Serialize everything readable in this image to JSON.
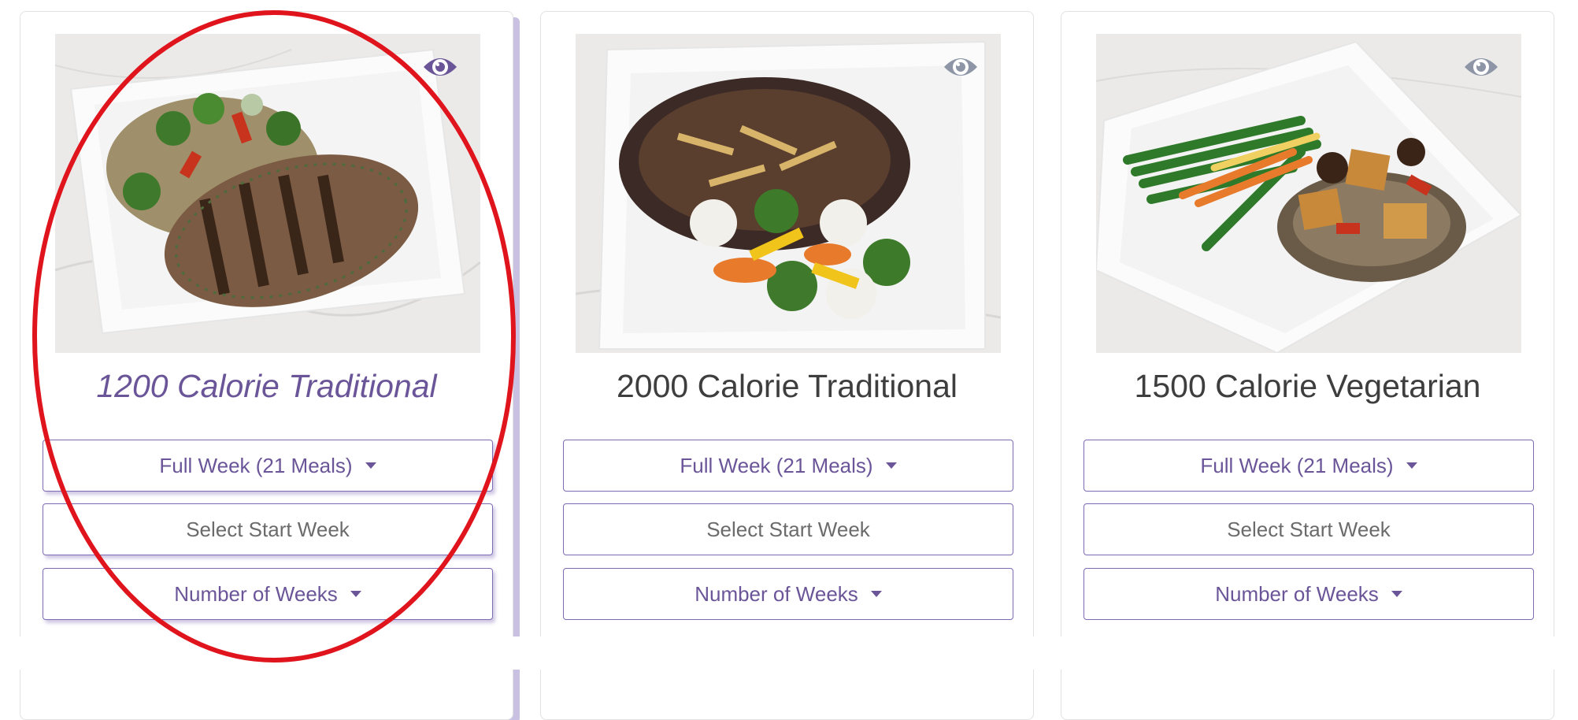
{
  "colors": {
    "accent": "#6a5598",
    "button_border": "#7c6ab3",
    "annotation": "#e0141c",
    "eye_icon": "#8d95a6",
    "eye_icon_active": "#6a5598"
  },
  "cards": [
    {
      "title": "1200 Calorie Traditional",
      "selected": true,
      "image": "grilled-chicken-plate",
      "eye_icon": "eye-icon",
      "meals_dropdown": "Full Week (21 Meals)",
      "start_week": "Select Start Week",
      "weeks_dropdown": "Number of Weeks"
    },
    {
      "title": "2000 Calorie Traditional",
      "selected": false,
      "image": "beef-rice-vegetable-plate",
      "eye_icon": "eye-icon",
      "meals_dropdown": "Full Week (21 Meals)",
      "start_week": "Select Start Week",
      "weeks_dropdown": "Number of Weeks"
    },
    {
      "title": "1500 Calorie Vegetarian",
      "selected": false,
      "image": "tofu-green-bean-plate",
      "eye_icon": "eye-icon",
      "meals_dropdown": "Full Week (21 Meals)",
      "start_week": "Select Start Week",
      "weeks_dropdown": "Number of Weeks"
    }
  ]
}
